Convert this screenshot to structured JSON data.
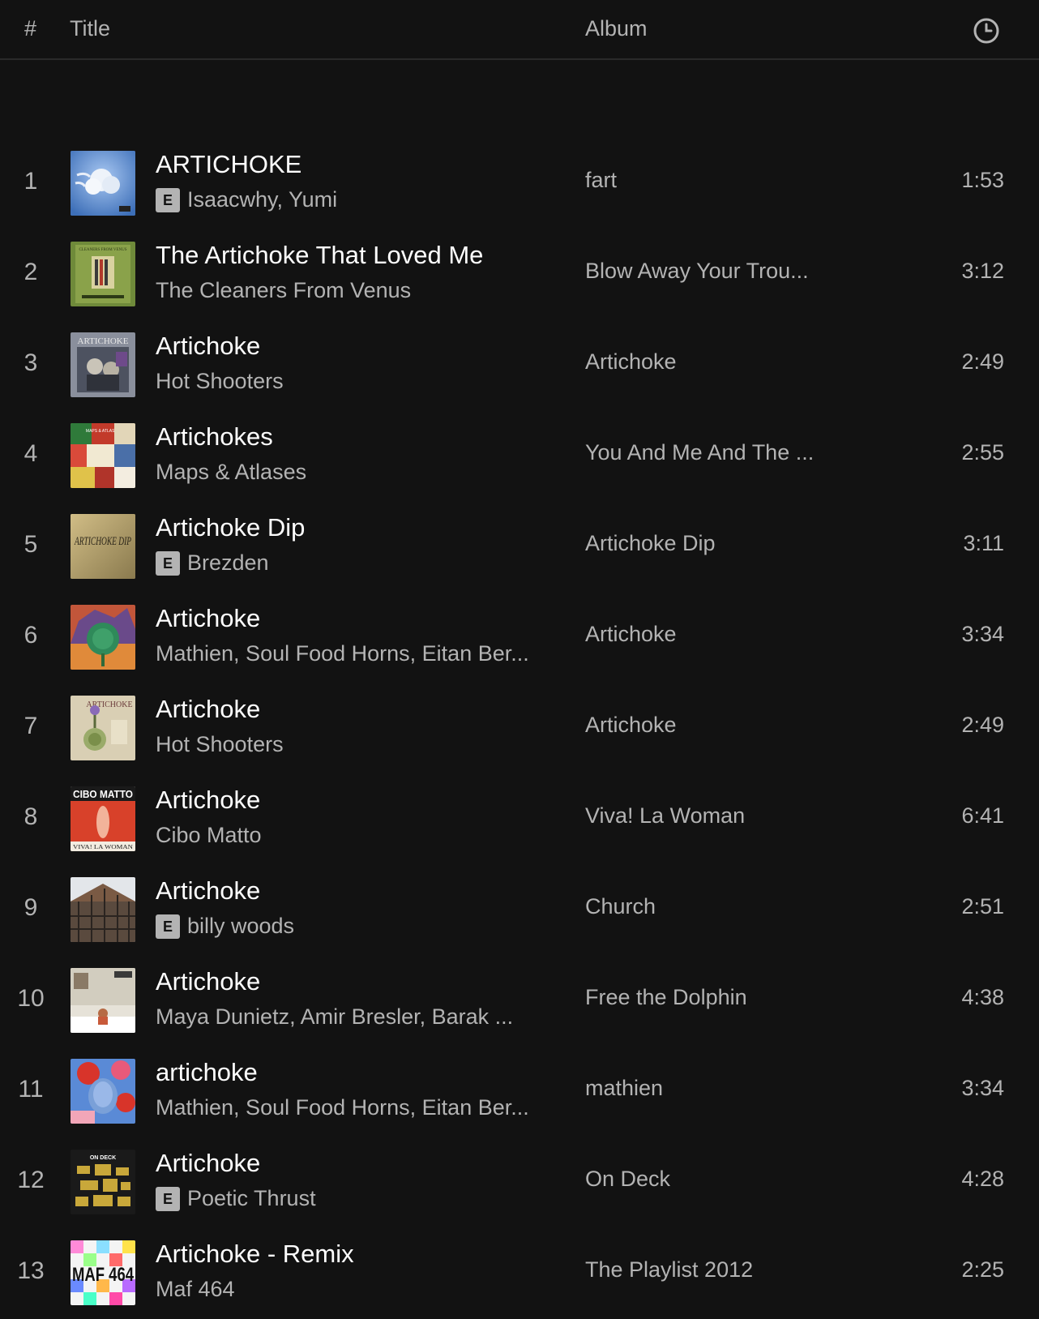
{
  "header": {
    "num_label": "#",
    "title_label": "Title",
    "album_label": "Album",
    "duration_icon": "clock-icon"
  },
  "tracks": [
    {
      "num": "1",
      "title": "ARTICHOKE",
      "explicit": true,
      "artist": "Isaacwhy, Yumi",
      "album": "fart",
      "duration": "1:53",
      "cover": "cloud-cover"
    },
    {
      "num": "2",
      "title": "The Artichoke That Loved Me",
      "explicit": false,
      "artist": "The Cleaners From Venus",
      "album": "Blow Away Your Trou...",
      "duration": "3:12",
      "cover": "green-book-cover"
    },
    {
      "num": "3",
      "title": "Artichoke",
      "explicit": false,
      "artist": "Hot Shooters",
      "album": "Artichoke",
      "duration": "2:49",
      "cover": "vintage-photo-cover"
    },
    {
      "num": "4",
      "title": "Artichokes",
      "explicit": false,
      "artist": "Maps & Atlases",
      "album": "You And Me And The ...",
      "duration": "2:55",
      "cover": "collage-cover"
    },
    {
      "num": "5",
      "title": "Artichoke Dip",
      "explicit": true,
      "artist": "Brezden",
      "album": "Artichoke Dip",
      "duration": "3:11",
      "cover": "lettering-cover"
    },
    {
      "num": "6",
      "title": "Artichoke",
      "explicit": false,
      "artist": "Mathien, Soul Food Horns, Eitan Ber...",
      "album": "Artichoke",
      "duration": "3:34",
      "cover": "painted-artichoke-cover"
    },
    {
      "num": "7",
      "title": "Artichoke",
      "explicit": false,
      "artist": "Hot Shooters",
      "album": "Artichoke",
      "duration": "2:49",
      "cover": "botanical-cover"
    },
    {
      "num": "8",
      "title": "Artichoke",
      "explicit": false,
      "artist": "Cibo Matto",
      "album": "Viva! La Woman",
      "duration": "6:41",
      "cover": "red-poster-cover"
    },
    {
      "num": "9",
      "title": "Artichoke",
      "explicit": true,
      "artist": "billy woods",
      "album": "Church",
      "duration": "2:51",
      "cover": "scaffold-cover"
    },
    {
      "num": "10",
      "title": "Artichoke",
      "explicit": false,
      "artist": "Maya Dunietz, Amir Bresler, Barak ...",
      "album": "Free the Dolphin",
      "duration": "4:38",
      "cover": "room-cover"
    },
    {
      "num": "11",
      "title": "artichoke",
      "explicit": false,
      "artist": "Mathien, Soul Food Horns, Eitan Ber...",
      "album": "mathien",
      "duration": "3:34",
      "cover": "floral-portrait-cover"
    },
    {
      "num": "12",
      "title": "Artichoke",
      "explicit": true,
      "artist": "Poetic Thrust",
      "album": "On Deck",
      "duration": "4:28",
      "cover": "gold-pattern-cover"
    },
    {
      "num": "13",
      "title": "Artichoke - Remix",
      "explicit": false,
      "artist": "Maf 464",
      "album": "The Playlist 2012",
      "duration": "2:25",
      "cover": "pixel-cover"
    }
  ],
  "explicit_label": "E",
  "cover_text": {
    "green_book": "CLEANERS FROM VENUS",
    "vintage": "ARTICHOKE",
    "collage": "MAPS & ATLASES",
    "lettering": "ARTICHOKE DIP",
    "botanical": "ARTICHOKE",
    "red_poster_top": "CIBO MATTO",
    "red_poster_bottom": "VIVA! LA WOMAN",
    "gold": "ON DECK",
    "pixel": "MAF 464"
  }
}
